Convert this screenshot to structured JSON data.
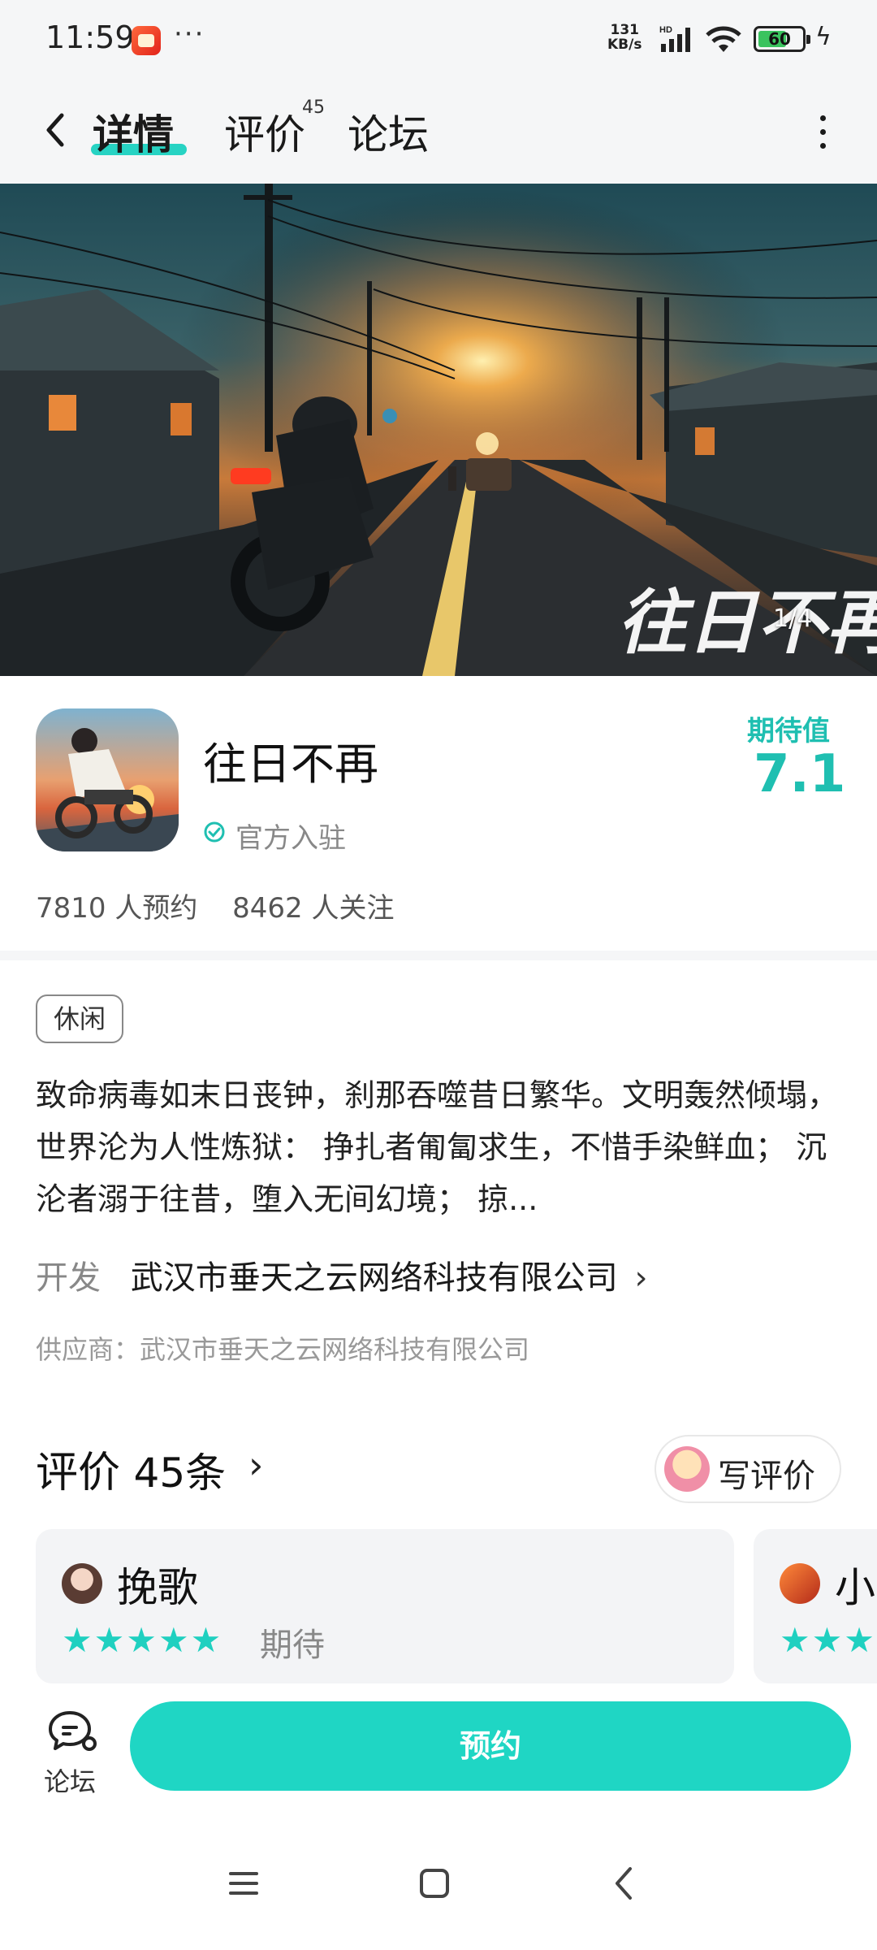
{
  "status_bar": {
    "time": "11:59",
    "dots": "···",
    "speed_top": "131",
    "speed_bottom": "KB/s",
    "network": "HD",
    "battery": "60"
  },
  "nav": {
    "tabs": [
      {
        "label": "详情",
        "active": true
      },
      {
        "label": "评价",
        "badge": "45"
      },
      {
        "label": "论坛"
      }
    ]
  },
  "banner": {
    "counter": "1/4",
    "title_art": "往日不再"
  },
  "app": {
    "name": "往日不再",
    "official_label": "官方入驻",
    "expect_label": "期待值",
    "expect_value": "7.1",
    "reservations": "7810 人预约",
    "followers": "8462 人关注"
  },
  "details": {
    "genre_tag": "休闲",
    "description": "致命病毒如末日丧钟，刹那吞噬昔日繁华。文明轰然倾塌，世界沦为人性炼狱： 挣扎者匍匐求生，不惜手染鲜血； 沉沦者溺于往昔，堕入无间幻境； 掠...",
    "developer_label": "开发",
    "developer_name": "武汉市垂天之云网络科技有限公司",
    "developer_chevron": "›",
    "supplier": "供应商：武汉市垂天之云网络科技有限公司"
  },
  "reviews": {
    "title": "评价",
    "count": "45条",
    "chevron": "›",
    "write_label": "写评价",
    "cards": [
      {
        "user": "挽歌",
        "stars": "★★★★★",
        "tag": "期待"
      },
      {
        "user": "小",
        "stars": "★★★★★"
      }
    ]
  },
  "bottom": {
    "forum_label": "论坛",
    "reserve_label": "预约"
  },
  "colors": {
    "accent": "#1fd6c4",
    "accent_text": "#1fbfb1"
  }
}
